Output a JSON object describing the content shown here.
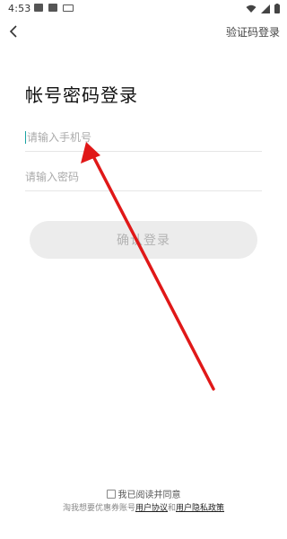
{
  "status_bar": {
    "time": "4:53"
  },
  "header": {
    "switch_label": "验证码登录"
  },
  "form": {
    "title": "帐号密码登录",
    "phone_placeholder": "请输入手机号",
    "password_placeholder": "请输入密码",
    "login_label": "确认登录"
  },
  "footer": {
    "agree_text": "我已阅读并同意",
    "policy_prefix": "淘我想要优惠券账号",
    "user_agreement": "用户协议",
    "and_text": "和",
    "privacy_policy": "用户隐私政策"
  },
  "annotation": {
    "arrow_color": "#e01818"
  }
}
